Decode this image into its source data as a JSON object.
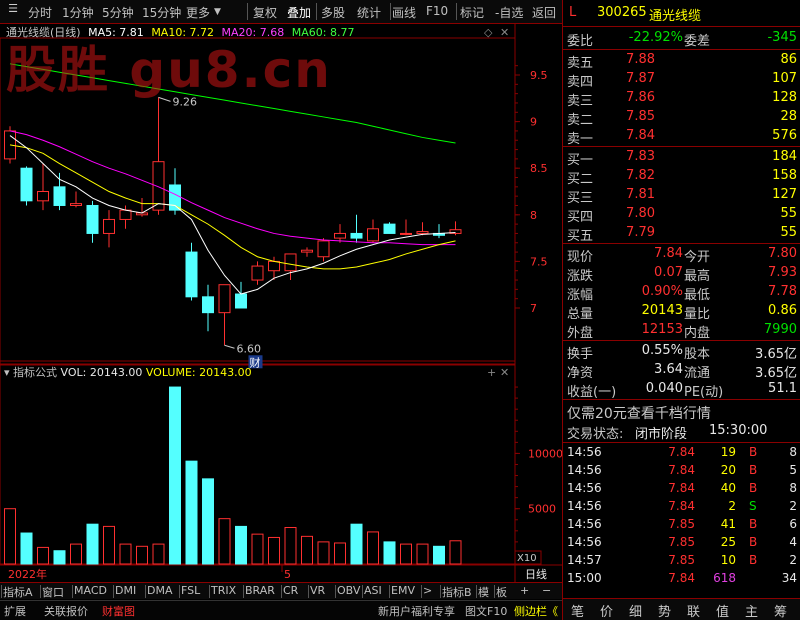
{
  "toolbar": {
    "items": [
      "分时",
      "1分钟",
      "5分钟",
      "15分钟",
      "更多",
      "复权",
      "叠加",
      "多股",
      "统计",
      "画线",
      "F10",
      "标记",
      "-自选",
      "返回"
    ]
  },
  "watermark": "股胜 gu8.cn",
  "chart_header": {
    "stock_name": "通光线缆(日线)",
    "ma5": "MA5: 7.81",
    "ma10": "MA10: 7.72",
    "ma20": "MA20: 7.68",
    "ma60": "MA60: 8.77"
  },
  "colors": {
    "up": "#ff3030",
    "down": "#54ffff",
    "ma5": "#ffffff",
    "ma10": "#ffff00",
    "ma20": "#ff00ff",
    "ma60": "#00ff00",
    "frame": "#8a0000"
  },
  "chart_data": [
    {
      "type": "candlestick",
      "y_ticks": [
        9.5,
        9.0,
        8.5,
        8.0,
        7.5,
        7.0
      ],
      "ylim": [
        6.45,
        9.95
      ],
      "annotations": {
        "high_label": "9.26",
        "low_label": "6.60",
        "finance_marker": "财"
      },
      "candles": [
        {
          "o": 8.6,
          "h": 8.95,
          "l": 8.55,
          "c": 8.9
        },
        {
          "o": 8.5,
          "h": 8.52,
          "l": 8.1,
          "c": 8.15
        },
        {
          "o": 8.15,
          "h": 8.55,
          "l": 8.05,
          "c": 8.25
        },
        {
          "o": 8.3,
          "h": 8.45,
          "l": 8.05,
          "c": 8.1
        },
        {
          "o": 8.1,
          "h": 8.25,
          "l": 8.08,
          "c": 8.12
        },
        {
          "o": 8.1,
          "h": 8.15,
          "l": 7.7,
          "c": 7.8
        },
        {
          "o": 7.8,
          "h": 8.05,
          "l": 7.65,
          "c": 7.95
        },
        {
          "o": 7.95,
          "h": 8.1,
          "l": 7.85,
          "c": 8.05
        },
        {
          "o": 8.0,
          "h": 8.18,
          "l": 7.98,
          "c": 8.02
        },
        {
          "o": 8.05,
          "h": 9.26,
          "l": 8.0,
          "c": 8.57
        },
        {
          "o": 8.32,
          "h": 8.5,
          "l": 8.0,
          "c": 8.05
        },
        {
          "o": 7.6,
          "h": 7.7,
          "l": 7.08,
          "c": 7.12
        },
        {
          "o": 7.12,
          "h": 7.25,
          "l": 6.75,
          "c": 6.95
        },
        {
          "o": 6.95,
          "h": 7.25,
          "l": 6.6,
          "c": 7.25
        },
        {
          "o": 7.15,
          "h": 7.28,
          "l": 7.0,
          "c": 7.0
        },
        {
          "o": 7.3,
          "h": 7.5,
          "l": 7.25,
          "c": 7.45
        },
        {
          "o": 7.4,
          "h": 7.55,
          "l": 7.3,
          "c": 7.5
        },
        {
          "o": 7.4,
          "h": 7.58,
          "l": 7.3,
          "c": 7.58
        },
        {
          "o": 7.6,
          "h": 7.65,
          "l": 7.55,
          "c": 7.62
        },
        {
          "o": 7.55,
          "h": 7.75,
          "l": 7.5,
          "c": 7.72
        },
        {
          "o": 7.75,
          "h": 7.9,
          "l": 7.7,
          "c": 7.8
        },
        {
          "o": 7.8,
          "h": 8.0,
          "l": 7.7,
          "c": 7.75
        },
        {
          "o": 7.72,
          "h": 7.95,
          "l": 7.7,
          "c": 7.85
        },
        {
          "o": 7.9,
          "h": 7.92,
          "l": 7.8,
          "c": 7.8
        },
        {
          "o": 7.8,
          "h": 7.95,
          "l": 7.78,
          "c": 7.8
        },
        {
          "o": 7.8,
          "h": 7.92,
          "l": 7.78,
          "c": 7.82
        },
        {
          "o": 7.8,
          "h": 7.9,
          "l": 7.75,
          "c": 7.78
        },
        {
          "o": 7.8,
          "h": 7.93,
          "l": 7.78,
          "c": 7.84
        }
      ],
      "ma5": [
        8.85,
        8.72,
        8.55,
        8.38,
        8.3,
        8.18,
        8.1,
        8.05,
        8.02,
        8.12,
        8.1,
        7.95,
        7.62,
        7.35,
        7.15,
        7.2,
        7.32,
        7.38,
        7.42,
        7.48,
        7.56,
        7.63,
        7.68,
        7.73,
        7.76,
        7.79,
        7.8,
        7.81
      ],
      "ma10": [
        8.75,
        8.72,
        8.66,
        8.55,
        8.45,
        8.35,
        8.25,
        8.18,
        8.12,
        8.12,
        8.1,
        8.0,
        7.9,
        7.78,
        7.65,
        7.55,
        7.5,
        7.47,
        7.44,
        7.42,
        7.42,
        7.44,
        7.48,
        7.52,
        7.58,
        7.63,
        7.68,
        7.72
      ],
      "ma20": [
        8.9,
        8.86,
        8.8,
        8.73,
        8.65,
        8.57,
        8.5,
        8.44,
        8.37,
        8.3,
        8.22,
        8.13,
        8.05,
        7.97,
        7.91,
        7.85,
        7.8,
        7.77,
        7.75,
        7.73,
        7.72,
        7.71,
        7.7,
        7.7,
        7.69,
        7.68,
        7.68,
        7.68
      ],
      "ma60": [
        9.62,
        9.59,
        9.56,
        9.53,
        9.5,
        9.47,
        9.44,
        9.41,
        9.38,
        9.35,
        9.32,
        9.29,
        9.26,
        9.23,
        9.2,
        9.17,
        9.14,
        9.11,
        9.08,
        9.05,
        9.02,
        8.99,
        8.95,
        8.91,
        8.87,
        8.83,
        8.8,
        8.77
      ]
    },
    {
      "type": "bar",
      "label": "指标公式",
      "vol_text": "VOL: 20143.00",
      "volume_text": "VOLUME: 20143.00",
      "y_ticks": [
        10000,
        5000
      ],
      "ylim": [
        0,
        17000
      ],
      "unit": "X10",
      "values": [
        5000,
        2800,
        1500,
        1200,
        1800,
        3600,
        3400,
        1800,
        1600,
        1800,
        16000,
        9300,
        7700,
        4100,
        3400,
        2700,
        2400,
        3300,
        2500,
        2000,
        1900,
        3600,
        2900,
        2000,
        1800,
        1800,
        1600,
        2100
      ]
    }
  ],
  "x_axis": {
    "year": "2022年",
    "month": "5",
    "period": "日线"
  },
  "indicator_tabs": [
    "指标A",
    "窗口",
    "MACD",
    "DMI",
    "DMA",
    "FSL",
    "TRIX",
    "BRAR",
    "CR",
    "VR",
    "OBV",
    "ASI",
    "EMV",
    ">",
    "指标B",
    "模",
    "板"
  ],
  "status_bar": {
    "left": [
      "扩展",
      "关联报价",
      "财富图"
    ],
    "right": [
      "新用户福利专享",
      "图文F10",
      "侧边栏《"
    ]
  },
  "quote": {
    "tag": "L",
    "code": "300265",
    "name": "通光线缆",
    "webi_label": "委比",
    "webi": "-22.92%",
    "weicha_label": "委差",
    "weicha": "-345",
    "asks": [
      {
        "label": "卖五",
        "price": "7.88",
        "vol": "86"
      },
      {
        "label": "卖四",
        "price": "7.87",
        "vol": "107"
      },
      {
        "label": "卖三",
        "price": "7.86",
        "vol": "128"
      },
      {
        "label": "卖二",
        "price": "7.85",
        "vol": "28"
      },
      {
        "label": "卖一",
        "price": "7.84",
        "vol": "576"
      }
    ],
    "bids": [
      {
        "label": "买一",
        "price": "7.83",
        "vol": "184"
      },
      {
        "label": "买二",
        "price": "7.82",
        "vol": "158"
      },
      {
        "label": "买三",
        "price": "7.81",
        "vol": "127"
      },
      {
        "label": "买四",
        "price": "7.80",
        "vol": "55"
      },
      {
        "label": "买五",
        "price": "7.79",
        "vol": "55"
      }
    ],
    "stats": [
      {
        "l": "现价",
        "v": "7.84",
        "vc": "red",
        "l2": "今开",
        "v2": "7.80",
        "v2c": "red"
      },
      {
        "l": "涨跌",
        "v": "0.07",
        "vc": "red",
        "l2": "最高",
        "v2": "7.93",
        "v2c": "red"
      },
      {
        "l": "涨幅",
        "v": "0.90%",
        "vc": "red",
        "l2": "最低",
        "v2": "7.78",
        "v2c": "red"
      },
      {
        "l": "总量",
        "v": "20143",
        "vc": "yellow",
        "l2": "量比",
        "v2": "0.86",
        "v2c": "yellow"
      },
      {
        "l": "外盘",
        "v": "12153",
        "vc": "red",
        "l2": "内盘",
        "v2": "7990",
        "v2c": "green"
      }
    ],
    "fund": [
      {
        "l": "换手",
        "v": "0.55%",
        "l2": "股本",
        "v2": "3.65亿"
      },
      {
        "l": "净资",
        "v": "3.64",
        "l2": "流通",
        "v2": "3.65亿"
      },
      {
        "l": "收益(一)",
        "v": "0.040",
        "l2": "PE(动)",
        "v2": "51.1"
      }
    ],
    "promo": "仅需20元查看千档行情",
    "trade_state_label": "交易状态:",
    "trade_state": "闭市阶段",
    "trade_time": "15:30:00",
    "ticks": [
      {
        "t": "14:56",
        "p": "7.84",
        "q": "19",
        "d": "B",
        "n": "8"
      },
      {
        "t": "14:56",
        "p": "7.84",
        "q": "20",
        "d": "B",
        "n": "5"
      },
      {
        "t": "14:56",
        "p": "7.84",
        "q": "40",
        "d": "B",
        "n": "8"
      },
      {
        "t": "14:56",
        "p": "7.84",
        "q": "2",
        "d": "S",
        "n": "2"
      },
      {
        "t": "14:56",
        "p": "7.85",
        "q": "41",
        "d": "B",
        "n": "6"
      },
      {
        "t": "14:56",
        "p": "7.85",
        "q": "25",
        "d": "B",
        "n": "4"
      },
      {
        "t": "14:57",
        "p": "7.85",
        "q": "10",
        "d": "B",
        "n": "2"
      },
      {
        "t": "15:00",
        "p": "7.84",
        "q": "618",
        "d": "",
        "n": "34"
      }
    ],
    "bottom_tabs": [
      "笔",
      "价",
      "细",
      "势",
      "联",
      "值",
      "主",
      "筹"
    ]
  }
}
